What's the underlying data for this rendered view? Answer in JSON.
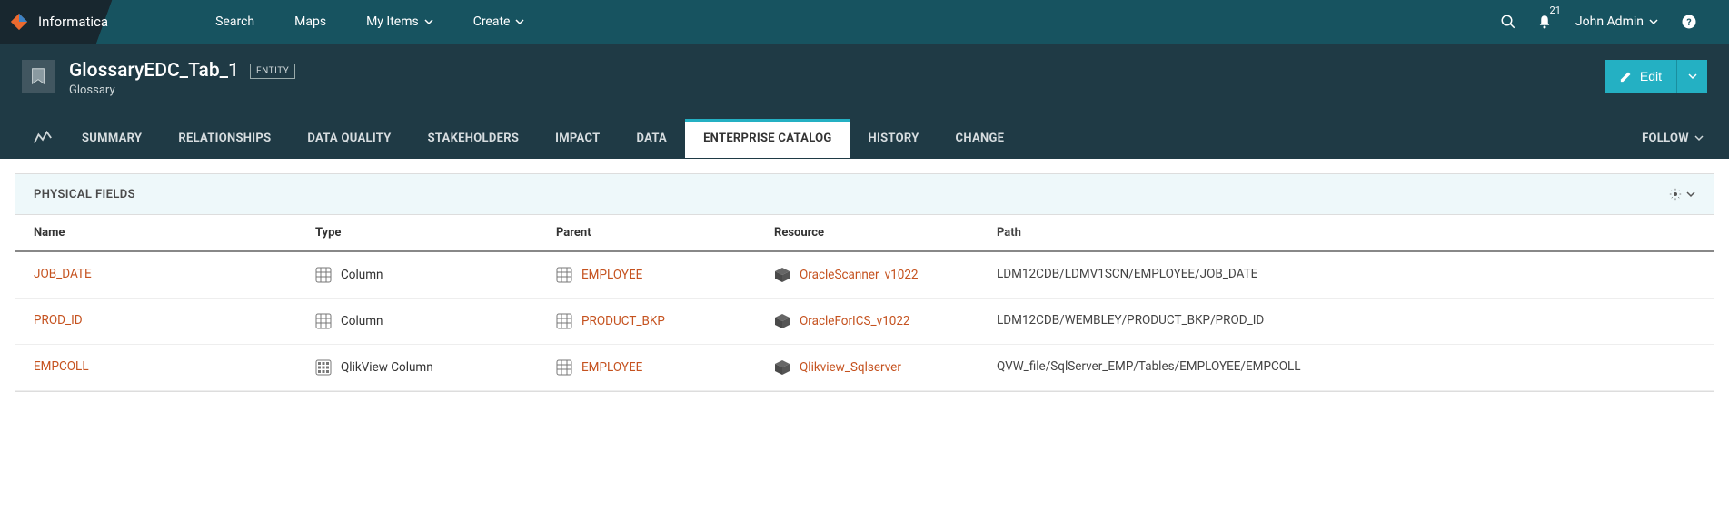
{
  "brand": {
    "name": "Informatica"
  },
  "nav": {
    "search": "Search",
    "maps": "Maps",
    "myItems": "My Items",
    "create": "Create",
    "notifCount": "21",
    "user": "John Admin"
  },
  "header": {
    "title": "GlossaryEDC_Tab_1",
    "typePill": "ENTITY",
    "subtitle": "Glossary",
    "editLabel": "Edit"
  },
  "tabs": {
    "summary": "SUMMARY",
    "relationships": "RELATIONSHIPS",
    "dataQuality": "DATA QUALITY",
    "stakeholders": "STAKEHOLDERS",
    "impact": "IMPACT",
    "data": "DATA",
    "enterpriseCatalog": "ENTERPRISE CATALOG",
    "history": "HISTORY",
    "change": "CHANGE",
    "follow": "FOLLOW"
  },
  "panel": {
    "title": "PHYSICAL FIELDS"
  },
  "table": {
    "headers": {
      "name": "Name",
      "type": "Type",
      "parent": "Parent",
      "resource": "Resource",
      "path": "Path"
    },
    "rows": [
      {
        "name": "JOB_DATE",
        "type": "Column",
        "parent": "EMPLOYEE",
        "resource": "OracleScanner_v1022",
        "path": "LDM12CDB/LDMV1SCN/EMPLOYEE/JOB_DATE"
      },
      {
        "name": "PROD_ID",
        "type": "Column",
        "parent": "PRODUCT_BKP",
        "resource": "OracleForICS_v1022",
        "path": "LDM12CDB/WEMBLEY/PRODUCT_BKP/PROD_ID"
      },
      {
        "name": "EMPCOLL",
        "type": "QlikView Column",
        "parent": "EMPLOYEE",
        "resource": "Qlikview_Sqlserver",
        "path": "QVW_file/SqlServer_EMP/Tables/EMPLOYEE/EMPCOLL"
      }
    ]
  }
}
